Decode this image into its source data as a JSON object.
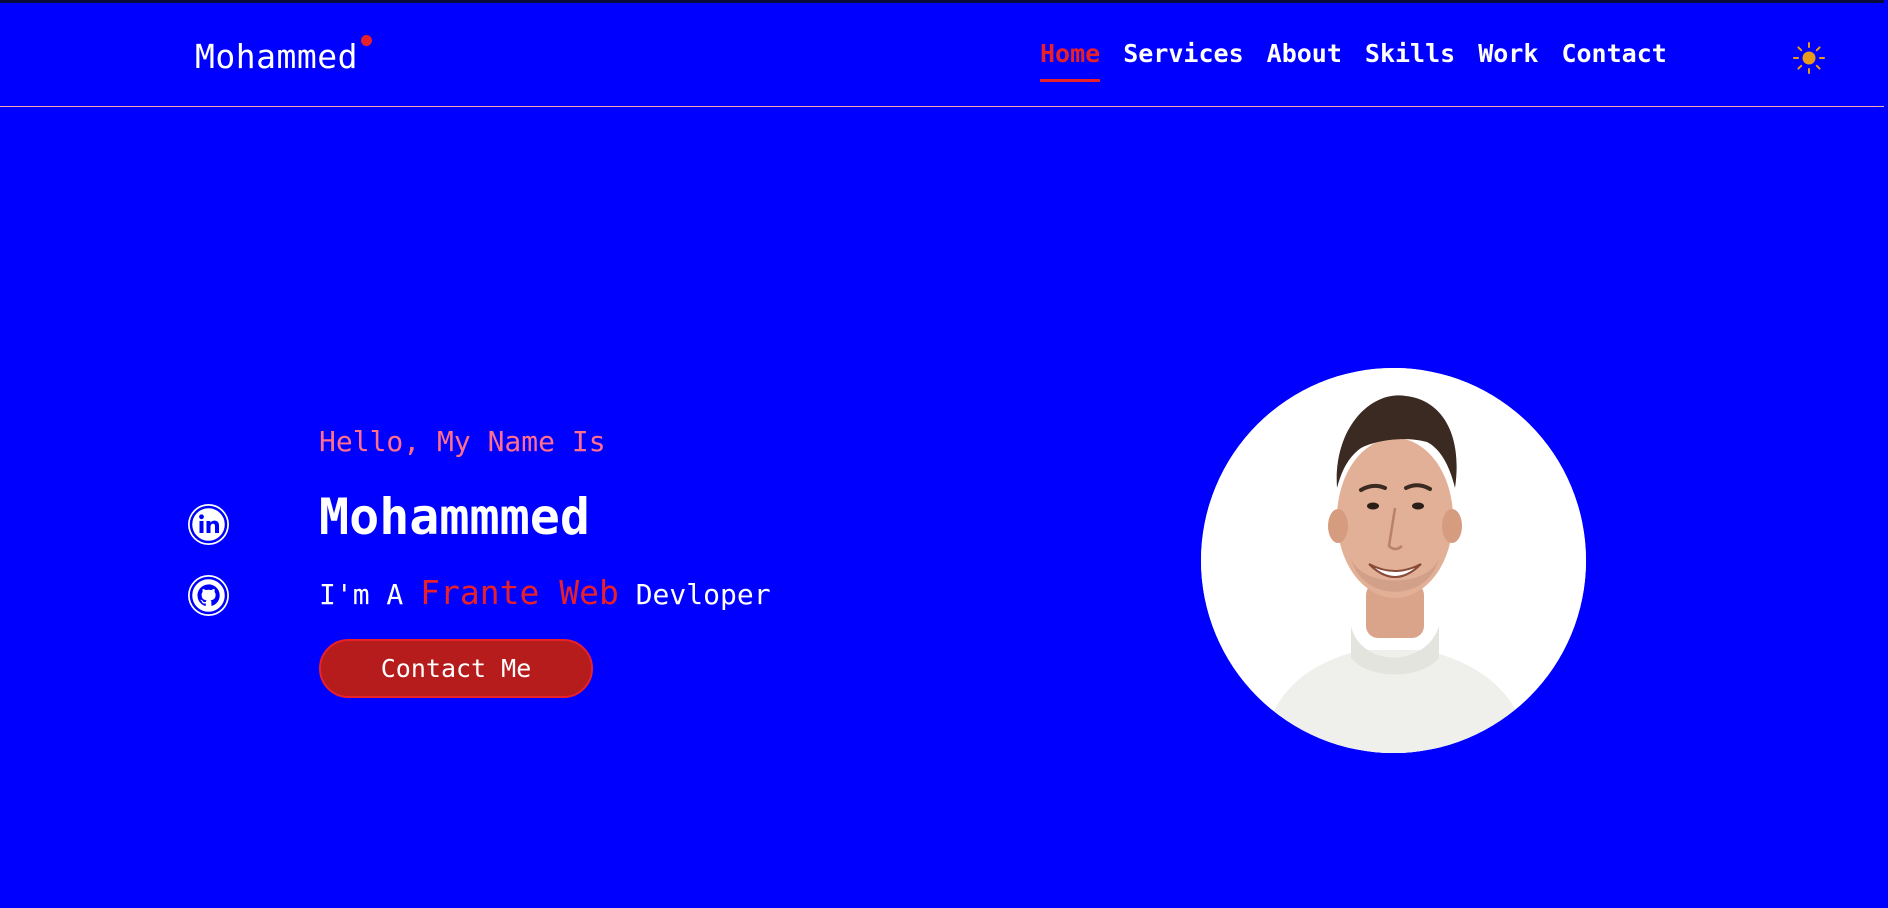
{
  "header": {
    "logo": "Mohammed",
    "nav": [
      {
        "label": "Home",
        "active": true
      },
      {
        "label": "Services",
        "active": false
      },
      {
        "label": "About",
        "active": false
      },
      {
        "label": "Skills",
        "active": false
      },
      {
        "label": "Work",
        "active": false
      },
      {
        "label": "Contact",
        "active": false
      }
    ],
    "theme_icon": "sun-icon"
  },
  "social": [
    {
      "icon": "linkedin-icon"
    },
    {
      "icon": "github-icon"
    }
  ],
  "hero": {
    "greeting": "Hello, My Name Is",
    "name": "Mohammmed",
    "role_prefix": "I'm A ",
    "role_accent": "Frante Web",
    "role_suffix": " Devloper",
    "cta_label": "Contact Me"
  },
  "colors": {
    "background": "#0000ff",
    "accent": "#e8202a",
    "button": "#b71c1c",
    "greeting": "#ff6e8a",
    "sun": "#e89a1c"
  }
}
